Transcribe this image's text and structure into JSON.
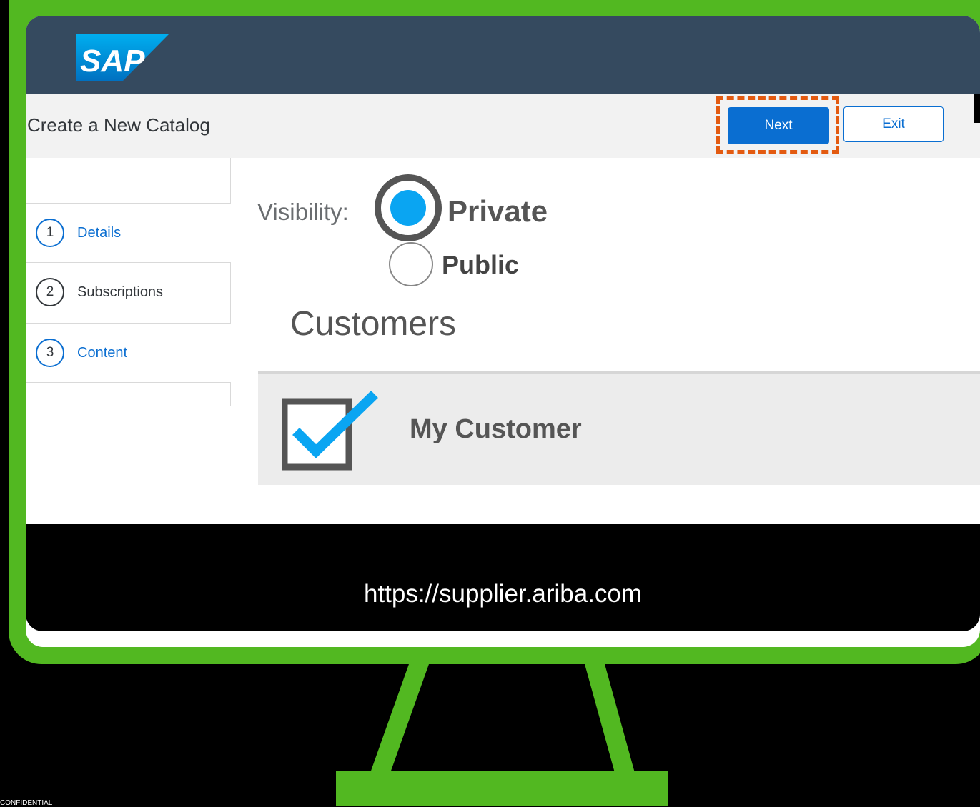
{
  "header": {
    "logo_text": "SAP"
  },
  "toolbar": {
    "title": "Create a New Catalog",
    "next_label": "Next",
    "exit_label": "Exit"
  },
  "steps": [
    {
      "num": "1",
      "label": "Details"
    },
    {
      "num": "2",
      "label": "Subscriptions"
    },
    {
      "num": "3",
      "label": "Content"
    }
  ],
  "visibility": {
    "label": "Visibility:",
    "options": [
      {
        "label": "Private",
        "selected": true
      },
      {
        "label": "Public",
        "selected": false
      }
    ]
  },
  "customers": {
    "title": "Customers",
    "items": [
      {
        "label": "My Customer",
        "checked": true
      }
    ]
  },
  "url": "https://supplier.ariba.com",
  "footer_note": "CONFIDENTIAL",
  "colors": {
    "frame": "#52b821",
    "header": "#354a5f",
    "primary": "#0a6ed1",
    "highlight": "#e35a10",
    "radio_fill": "#0aa5f2"
  }
}
